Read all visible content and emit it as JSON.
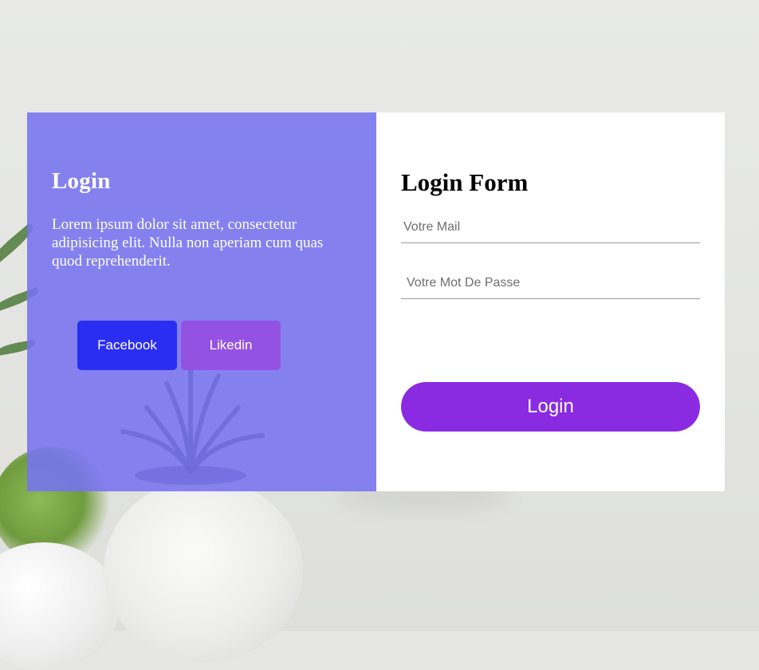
{
  "left": {
    "title": "Login",
    "text": "Lorem ipsum dolor sit amet, consectetur adipisicing elit. Nulla non aperiam cum quas quod reprehenderit.",
    "facebook_label": "Facebook",
    "linkedin_label": "Likedin"
  },
  "form": {
    "title": "Login Form",
    "email_placeholder": "Votre Mail",
    "email_value": "",
    "password_placeholder": "Votre Mot De Passe",
    "password_value": "",
    "submit_label": "Login"
  },
  "colors": {
    "left_panel": "#7673f0",
    "facebook": "#2a2ef2",
    "linkedin": "#9452e3",
    "login_button": "#8a2be2"
  }
}
